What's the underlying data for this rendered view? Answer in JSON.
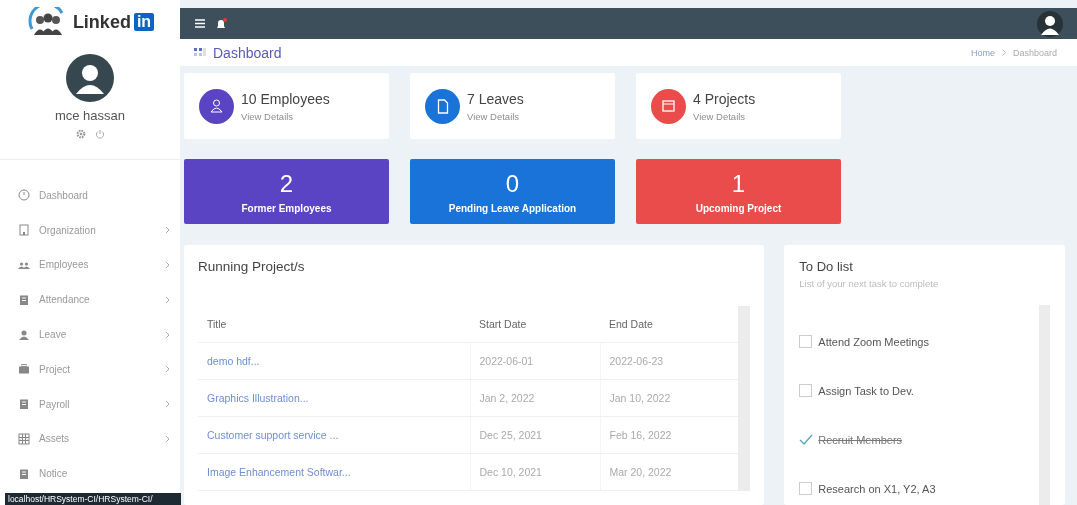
{
  "sidebar": {
    "logo": {
      "word": "Linked",
      "badge": "in"
    },
    "user": {
      "name": "mce hassan"
    },
    "items": [
      {
        "label": "Dashboard",
        "has_submenu": false
      },
      {
        "label": "Organization",
        "has_submenu": true
      },
      {
        "label": "Employees",
        "has_submenu": true
      },
      {
        "label": "Attendance",
        "has_submenu": true
      },
      {
        "label": "Leave",
        "has_submenu": true
      },
      {
        "label": "Project",
        "has_submenu": true
      },
      {
        "label": "Payroll",
        "has_submenu": true
      },
      {
        "label": "Assets",
        "has_submenu": true
      },
      {
        "label": "Notice",
        "has_submenu": false
      }
    ],
    "status_url": "localhost/HRSystem-CI/HRSystem-CI/"
  },
  "topbar": {
    "notification_dot": true
  },
  "header": {
    "title": "Dashboard",
    "breadcrumb": [
      "Home",
      "Dashboard"
    ]
  },
  "stat_cards": [
    {
      "title": "10 Employees",
      "link": "View Details",
      "color": "#5b44c4"
    },
    {
      "title": "7 Leaves",
      "link": "View Details",
      "color": "#1a73d9"
    },
    {
      "title": "4 Projects",
      "link": "View Details",
      "color": "#ea4c4c"
    }
  ],
  "summary_tiles": [
    {
      "value": "2",
      "label": "Former Employees",
      "color": "#5b44c4"
    },
    {
      "value": "0",
      "label": "Pending Leave Application",
      "color": "#1a73d9"
    },
    {
      "value": "1",
      "label": "Upcoming Project",
      "color": "#ea4c4c"
    }
  ],
  "running_projects": {
    "title": "Running Project/s",
    "columns": [
      "Title",
      "Start Date",
      "End Date"
    ],
    "rows": [
      [
        "demo hdf...",
        "2022-06-01",
        "2022-06-23"
      ],
      [
        "Graphics Illustration...",
        "Jan 2, 2022",
        "Jan 10, 2022"
      ],
      [
        "Customer support service ...",
        "Dec 25, 2021",
        "Feb 16, 2022"
      ],
      [
        "Image Enhancement Softwar...",
        "Dec 10, 2021",
        "Mar 20, 2022"
      ]
    ]
  },
  "todo": {
    "title": "To Do list",
    "subtitle": "List of your next task to complete",
    "items": [
      {
        "text": "Attend Zoom Meetings",
        "checked": false
      },
      {
        "text": "Assign Task to Dev.",
        "checked": false
      },
      {
        "text": "Recruit Members",
        "checked": true
      },
      {
        "text": "Research on X1, Y2, A3",
        "checked": false
      }
    ]
  }
}
